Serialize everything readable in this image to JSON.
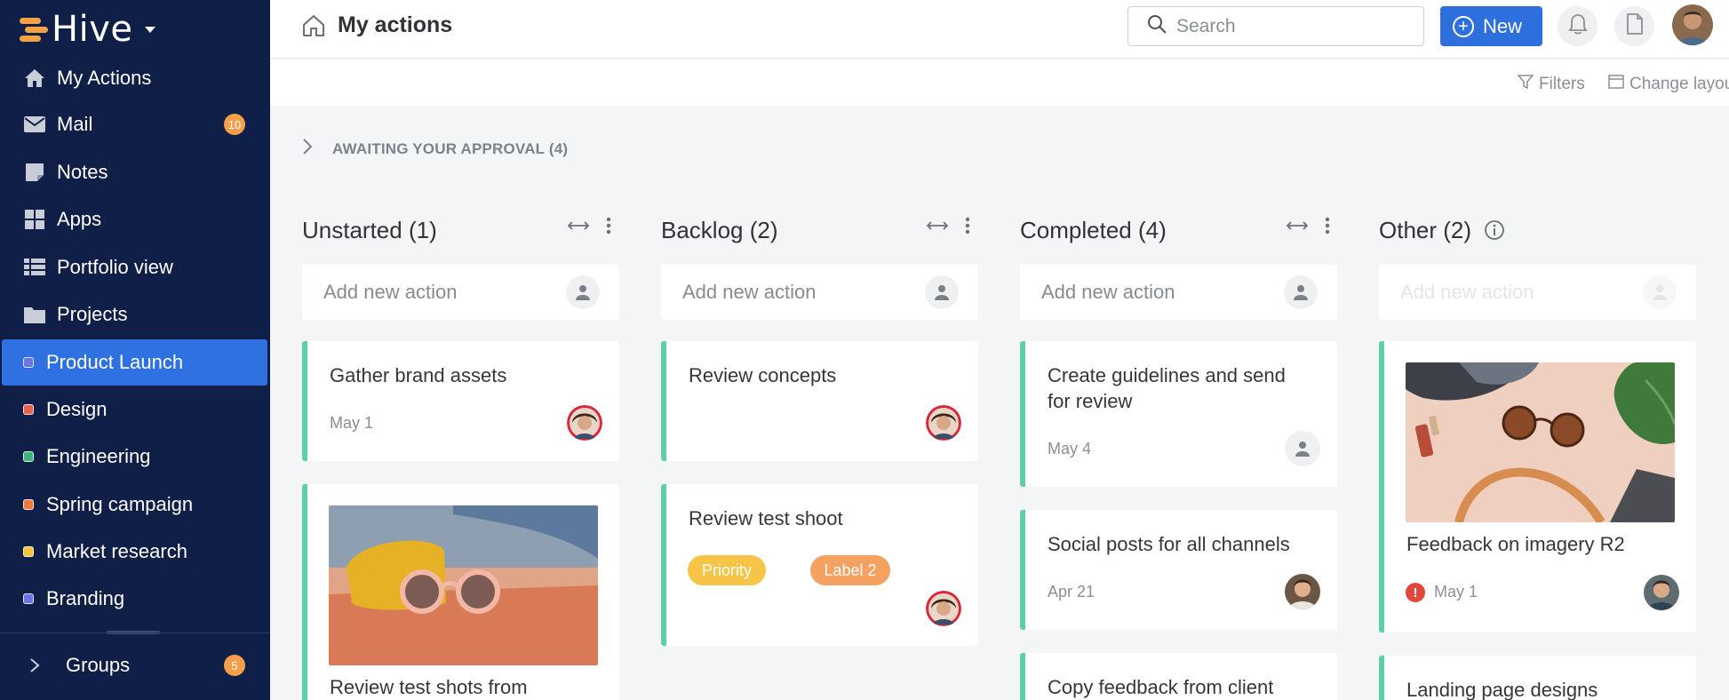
{
  "brand": {
    "name": "Hive",
    "accent": "#f5a144",
    "sidebar_bg": "#0f1f47",
    "primary": "#2d6fdd"
  },
  "sidebar": {
    "nav": [
      {
        "label": "My Actions",
        "icon": "home-icon"
      },
      {
        "label": "Mail",
        "icon": "mail-icon",
        "badge": "10"
      },
      {
        "label": "Notes",
        "icon": "note-icon"
      },
      {
        "label": "Apps",
        "icon": "apps-grid-icon"
      },
      {
        "label": "Portfolio view",
        "icon": "table-list-icon"
      },
      {
        "label": "Projects",
        "icon": "folder-icon"
      }
    ],
    "projects": [
      {
        "label": "Product Launch",
        "color": "#6c73e8",
        "active": true
      },
      {
        "label": "Design",
        "color": "#e86155"
      },
      {
        "label": "Engineering",
        "color": "#3fb37a"
      },
      {
        "label": "Spring campaign",
        "color": "#f07a3a"
      },
      {
        "label": "Market research",
        "color": "#f5c33b"
      },
      {
        "label": "Branding",
        "color": "#6c73e8"
      }
    ],
    "groups": {
      "label": "Groups",
      "badge": "5"
    }
  },
  "topbar": {
    "title": "My actions",
    "search_placeholder": "Search",
    "new_label": "New",
    "filters_label": "Filters",
    "layout_label": "Change layout"
  },
  "approval": {
    "label": "AWAITING YOUR APPROVAL (4)"
  },
  "columns": [
    {
      "title": "Unstarted (1)",
      "add_placeholder": "Add new action"
    },
    {
      "title": "Backlog (2)",
      "add_placeholder": "Add new action"
    },
    {
      "title": "Completed (4)",
      "add_placeholder": "Add new action"
    },
    {
      "title": "Other (2)",
      "add_placeholder": "Add new action"
    }
  ],
  "cards": {
    "c1": {
      "title": "Gather brand assets",
      "date": "May 1"
    },
    "c2": {
      "title": "Review test shots from"
    },
    "c3": {
      "title": "Review concepts"
    },
    "c4": {
      "title": "Review test shoot",
      "tags": [
        "Priority",
        "Label 2"
      ],
      "tag_colors": [
        "#f7c448",
        "#f4a162"
      ]
    },
    "c5": {
      "title_line1": "Create guidelines and send",
      "title_line2": "for review",
      "date": "May 4"
    },
    "c6": {
      "title": "Social posts for all channels",
      "date": "Apr 21"
    },
    "c7": {
      "title": "Copy feedback from client"
    },
    "c8": {
      "title": "Feedback on imagery R2",
      "date": "May 1"
    },
    "c9": {
      "title": "Landing page designs"
    }
  },
  "status_color": "#5fcfa4"
}
